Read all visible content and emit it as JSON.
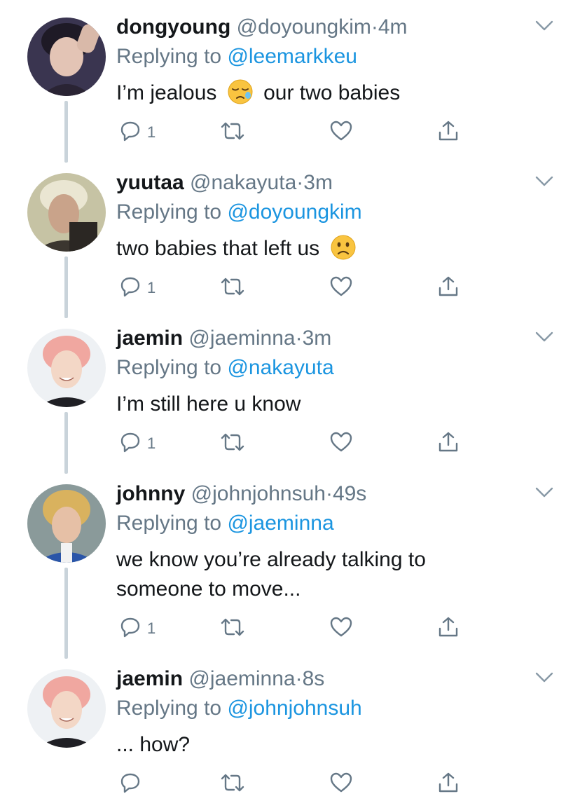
{
  "colors": {
    "name": "#14171a",
    "meta": "#657786",
    "link": "#1b95e0",
    "thread_line": "#c9d3da",
    "icon": "#657786"
  },
  "tweets": [
    {
      "name": "dongyoung",
      "handle": "@doyoungkim",
      "sep": "·",
      "time": "4m",
      "replying_prefix": "Replying to ",
      "replying_to": "@leemarkkeu",
      "text_before": "I’m jealous",
      "emoji": "sleepy-face-emoji",
      "text_after": "our two babies",
      "reply_count": "1"
    },
    {
      "name": "yuutaa",
      "handle": "@nakayuta",
      "sep": "·",
      "time": "3m",
      "replying_prefix": "Replying to ",
      "replying_to": "@doyoungkim",
      "text_before": "two babies that left us",
      "emoji": "slightly-frowning-face-emoji",
      "reply_count": "1"
    },
    {
      "name": "jaemin",
      "handle": "@jaeminna",
      "sep": "·",
      "time": "3m",
      "replying_prefix": "Replying to ",
      "replying_to": "@nakayuta",
      "text": "I’m still here u know",
      "reply_count": "1"
    },
    {
      "name": "johnny",
      "handle": "@johnjohnsuh",
      "sep": "·",
      "time": "49s",
      "replying_prefix": "Replying to ",
      "replying_to": "@jaeminna",
      "text_line1": "we know you’re already talking to",
      "text_line2": "someone to move...",
      "reply_count": "1"
    },
    {
      "name": "jaemin",
      "handle": "@jaeminna",
      "sep": "·",
      "time": "8s",
      "replying_prefix": "Replying to ",
      "replying_to": "@johnjohnsuh",
      "text": "... how?"
    }
  ]
}
